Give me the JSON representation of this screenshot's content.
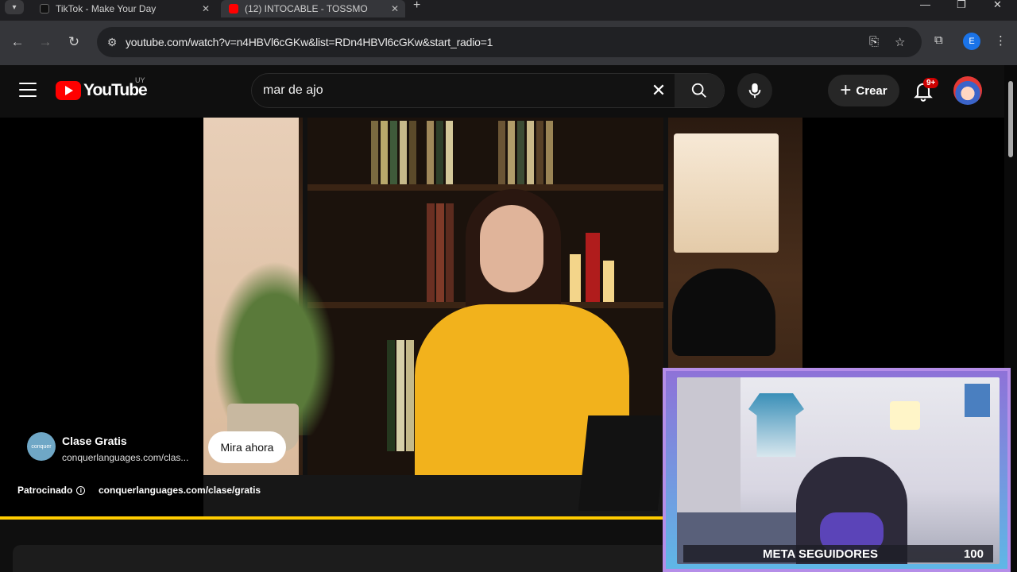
{
  "browser": {
    "tabs": [
      {
        "title": "TikTok - Make Your Day",
        "active": false
      },
      {
        "title": "(12) INTOCABLE - TOSSMO",
        "active": true
      }
    ],
    "url": "youtube.com/watch?v=n4HBVl6cGKw&list=RDn4HBVl6cGKw&start_radio=1",
    "profile_initial": "E"
  },
  "youtube": {
    "logo_text": "YouTube",
    "country_code": "UY",
    "search_query": "mar de ajo",
    "create_label": "Crear",
    "notification_count": "9+",
    "accent_color": "#ff0000"
  },
  "ad": {
    "icon_text": "conquer",
    "title": "Clase Gratis",
    "url_display": "conquerlanguages.com/clas...",
    "cta_label": "Mira ahora",
    "sponsored_label": "Patrocinado",
    "link": "conquerlanguages.com/clase/gratis",
    "progress_fraction": 0.66,
    "progress_color": "#ffcc00"
  },
  "stream_overlay": {
    "goal_label": "META SEGUIDORES",
    "goal_value": "100",
    "border_color": "#b58ee8"
  }
}
